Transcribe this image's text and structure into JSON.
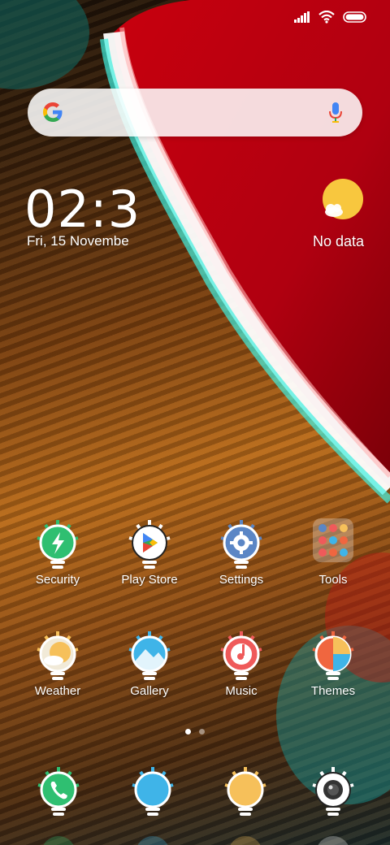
{
  "status_bar": {
    "icons": [
      "signal-icon",
      "wifi-icon",
      "battery-icon"
    ]
  },
  "search": {
    "logo": "google-g-logo",
    "mic_icon": "microphone-icon"
  },
  "clock": {
    "time": "02:3",
    "date": "Fri, 15 Novembe"
  },
  "weather": {
    "icon": "sun-cloud-icon",
    "label": "No data"
  },
  "apps": [
    {
      "label": "Security",
      "icon": "security-bolt-icon",
      "color": "#2fbf71"
    },
    {
      "label": "Play Store",
      "icon": "play-store-icon",
      "color": "#ffffff"
    },
    {
      "label": "Settings",
      "icon": "settings-gear-icon",
      "color": "#5b86c5"
    },
    {
      "label": "Tools",
      "icon": "tools-folder-icon",
      "color": "#e8b46a"
    },
    {
      "label": "Weather",
      "icon": "weather-icon",
      "color": "#f1ead8"
    },
    {
      "label": "Gallery",
      "icon": "gallery-icon",
      "color": "#3fb4e8"
    },
    {
      "label": "Music",
      "icon": "music-note-icon",
      "color": "#ef5a5a"
    },
    {
      "label": "Themes",
      "icon": "themes-icon",
      "color": "#f0663f"
    }
  ],
  "page_indicator": {
    "pages": 2,
    "current": 1
  },
  "dock": [
    {
      "icon": "phone-icon",
      "color": "#2fbf71"
    },
    {
      "icon": "messages-icon",
      "color": "#3fb4e8"
    },
    {
      "icon": "browser-icon",
      "color": "#f6c05a"
    },
    {
      "icon": "camera-icon",
      "color": "#ffffff"
    }
  ]
}
